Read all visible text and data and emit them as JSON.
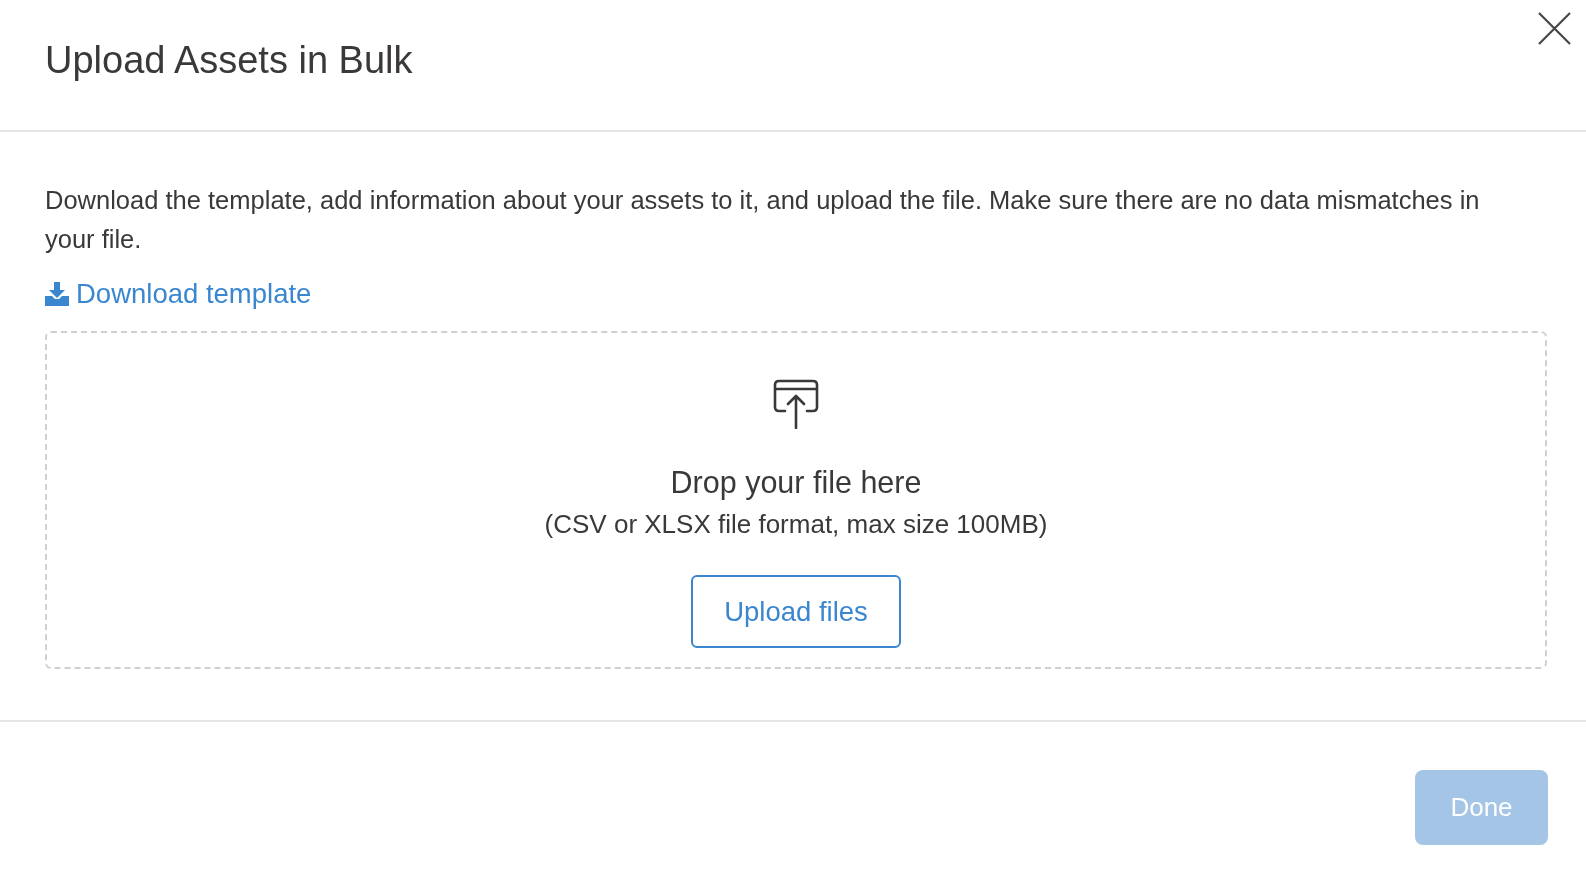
{
  "dialog": {
    "title": "Upload Assets in Bulk"
  },
  "description": "Download the template, add information about your assets to it, and upload the file. Make sure there are no data mismatches in your file.",
  "download_link": {
    "label": "Download template"
  },
  "dropzone": {
    "heading": "Drop your file here",
    "hint": "(CSV or XLSX file format, max size 100MB)",
    "button": {
      "label": "Upload files"
    }
  },
  "footer": {
    "buttons": [
      {
        "label": "Done",
        "kind": "primary",
        "disabled": true
      }
    ]
  }
}
